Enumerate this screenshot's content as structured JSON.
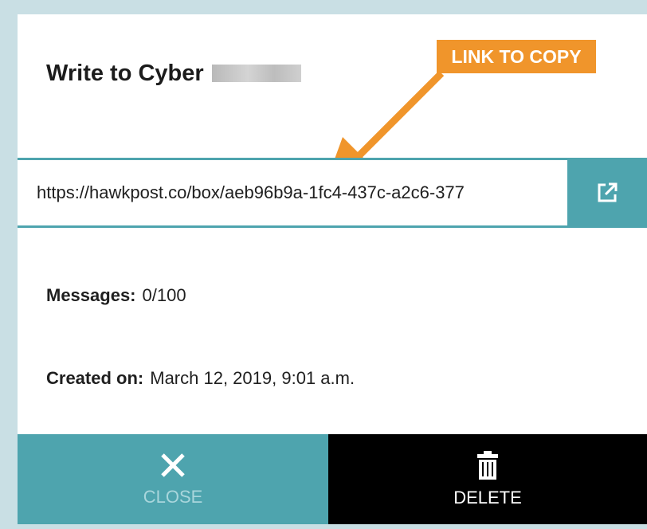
{
  "dialog": {
    "title": "Write to Cyber",
    "callout": "LINK TO COPY",
    "link": "https://hawkpost.co/box/aeb96b9a-1fc4-437c-a2c6-377",
    "open_icon": "external-link-icon",
    "messages_label": "Messages:",
    "messages_value": "0/100",
    "created_label": "Created on:",
    "created_value": "March 12, 2019, 9:01 a.m.",
    "close_label": "CLOSE",
    "close_icon": "close-icon",
    "delete_label": "DELETE",
    "delete_icon": "trash-icon"
  },
  "colors": {
    "accent": "#4ea4ae",
    "callout": "#f0952b",
    "delete_bg": "#000000"
  }
}
